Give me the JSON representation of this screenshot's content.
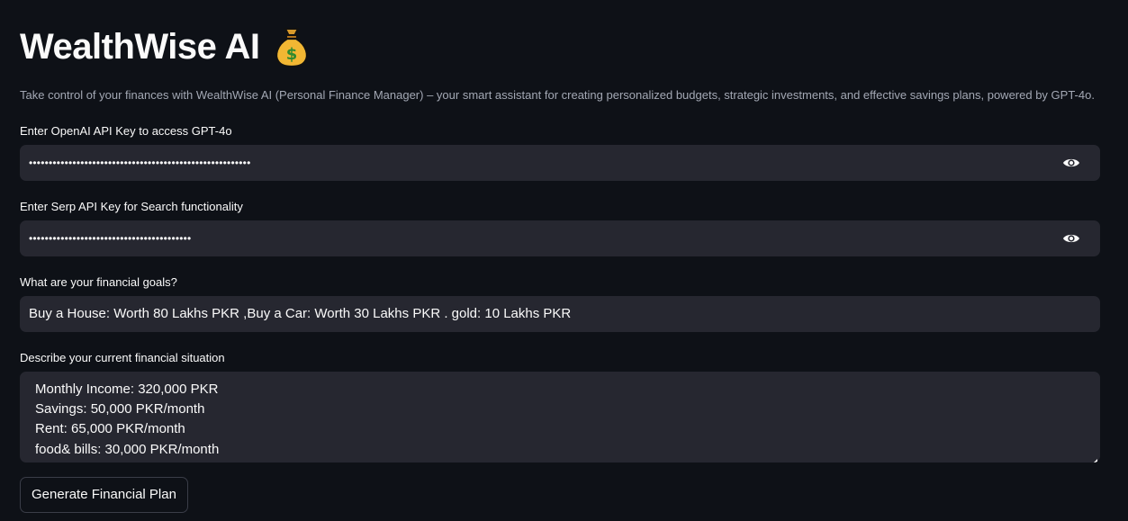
{
  "header": {
    "title": "WealthWise AI",
    "title_icon": "money-bag-icon",
    "subtitle": "Take control of your finances with WealthWise AI (Personal Finance Manager) – your smart assistant for creating personalized budgets, strategic investments, and effective savings plans, powered by GPT-4o."
  },
  "openai_key": {
    "label": "Enter OpenAI API Key to access GPT-4o",
    "masked_value": "••••••••••••••••••••••••••••••••••••••••••••••••••••••••",
    "toggle_icon": "eye-icon"
  },
  "serp_key": {
    "label": "Enter Serp API Key for Search functionality",
    "masked_value": "•••••••••••••••••••••••••••••••••••••••••",
    "toggle_icon": "eye-icon"
  },
  "goals": {
    "label": "What are your financial goals?",
    "value": "Buy a House: Worth 80 Lakhs PKR ,Buy a Car: Worth 30 Lakhs PKR . gold: 10 Lakhs PKR"
  },
  "situation": {
    "label": "Describe your current financial situation",
    "lines": [
      "Monthly Income: 320,000 PKR",
      "Savings: 50,000 PKR/month",
      "Rent: 65,000 PKR/month",
      "food& bills: 30,000 PKR/month"
    ]
  },
  "actions": {
    "generate_label": "Generate Financial Plan"
  },
  "colors": {
    "background": "#0e1117",
    "input_background": "#262730",
    "text": "#fafafa",
    "muted_text": "#a3a8b4"
  }
}
